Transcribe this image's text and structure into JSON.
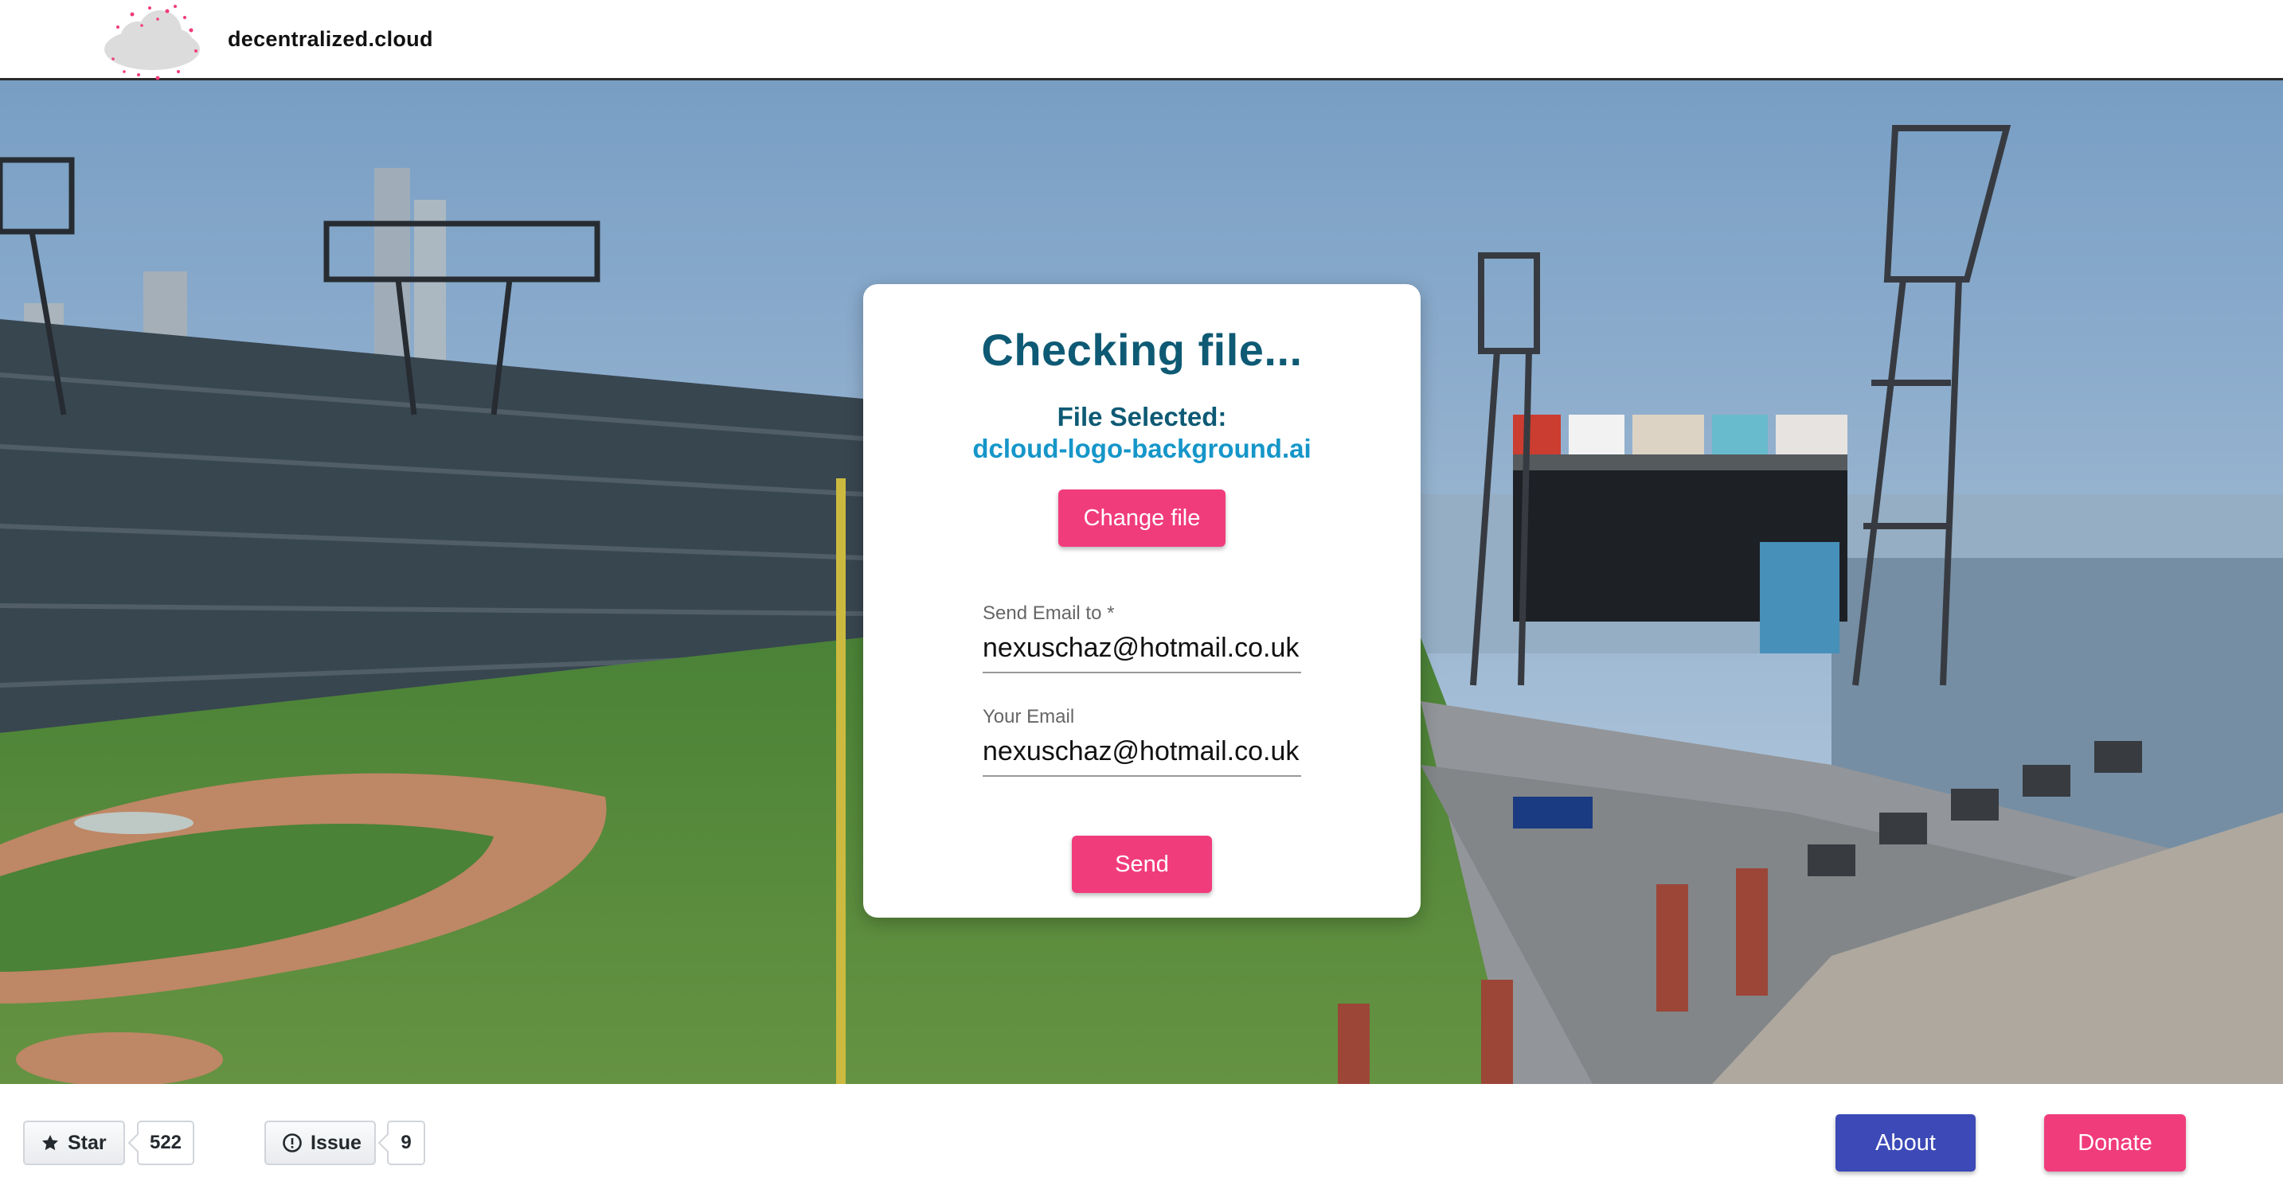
{
  "header": {
    "brand": "decentralized.cloud"
  },
  "card": {
    "title": "Checking file...",
    "file_selected_label": "File Selected:",
    "file_name": "dcloud-logo-background.ai",
    "change_file_label": "Change file",
    "send_email_to": {
      "label": "Send Email to *",
      "value": "nexuschaz@hotmail.co.uk"
    },
    "your_email": {
      "label": "Your Email",
      "value": "nexuschaz@hotmail.co.uk"
    },
    "send_label": "Send"
  },
  "footer": {
    "star": {
      "label": "Star",
      "count": "522"
    },
    "issue": {
      "label": "Issue",
      "count": "9"
    },
    "about_label": "About",
    "donate_label": "Donate"
  },
  "colors": {
    "accent_pink": "#f13c7c",
    "title_teal": "#0e5a74",
    "file_blue": "#1596c9",
    "about_indigo": "#3c49b6"
  },
  "icons": {
    "logo": "cloud-logo-icon",
    "star": "star-icon",
    "issue": "issue-opened-icon"
  }
}
